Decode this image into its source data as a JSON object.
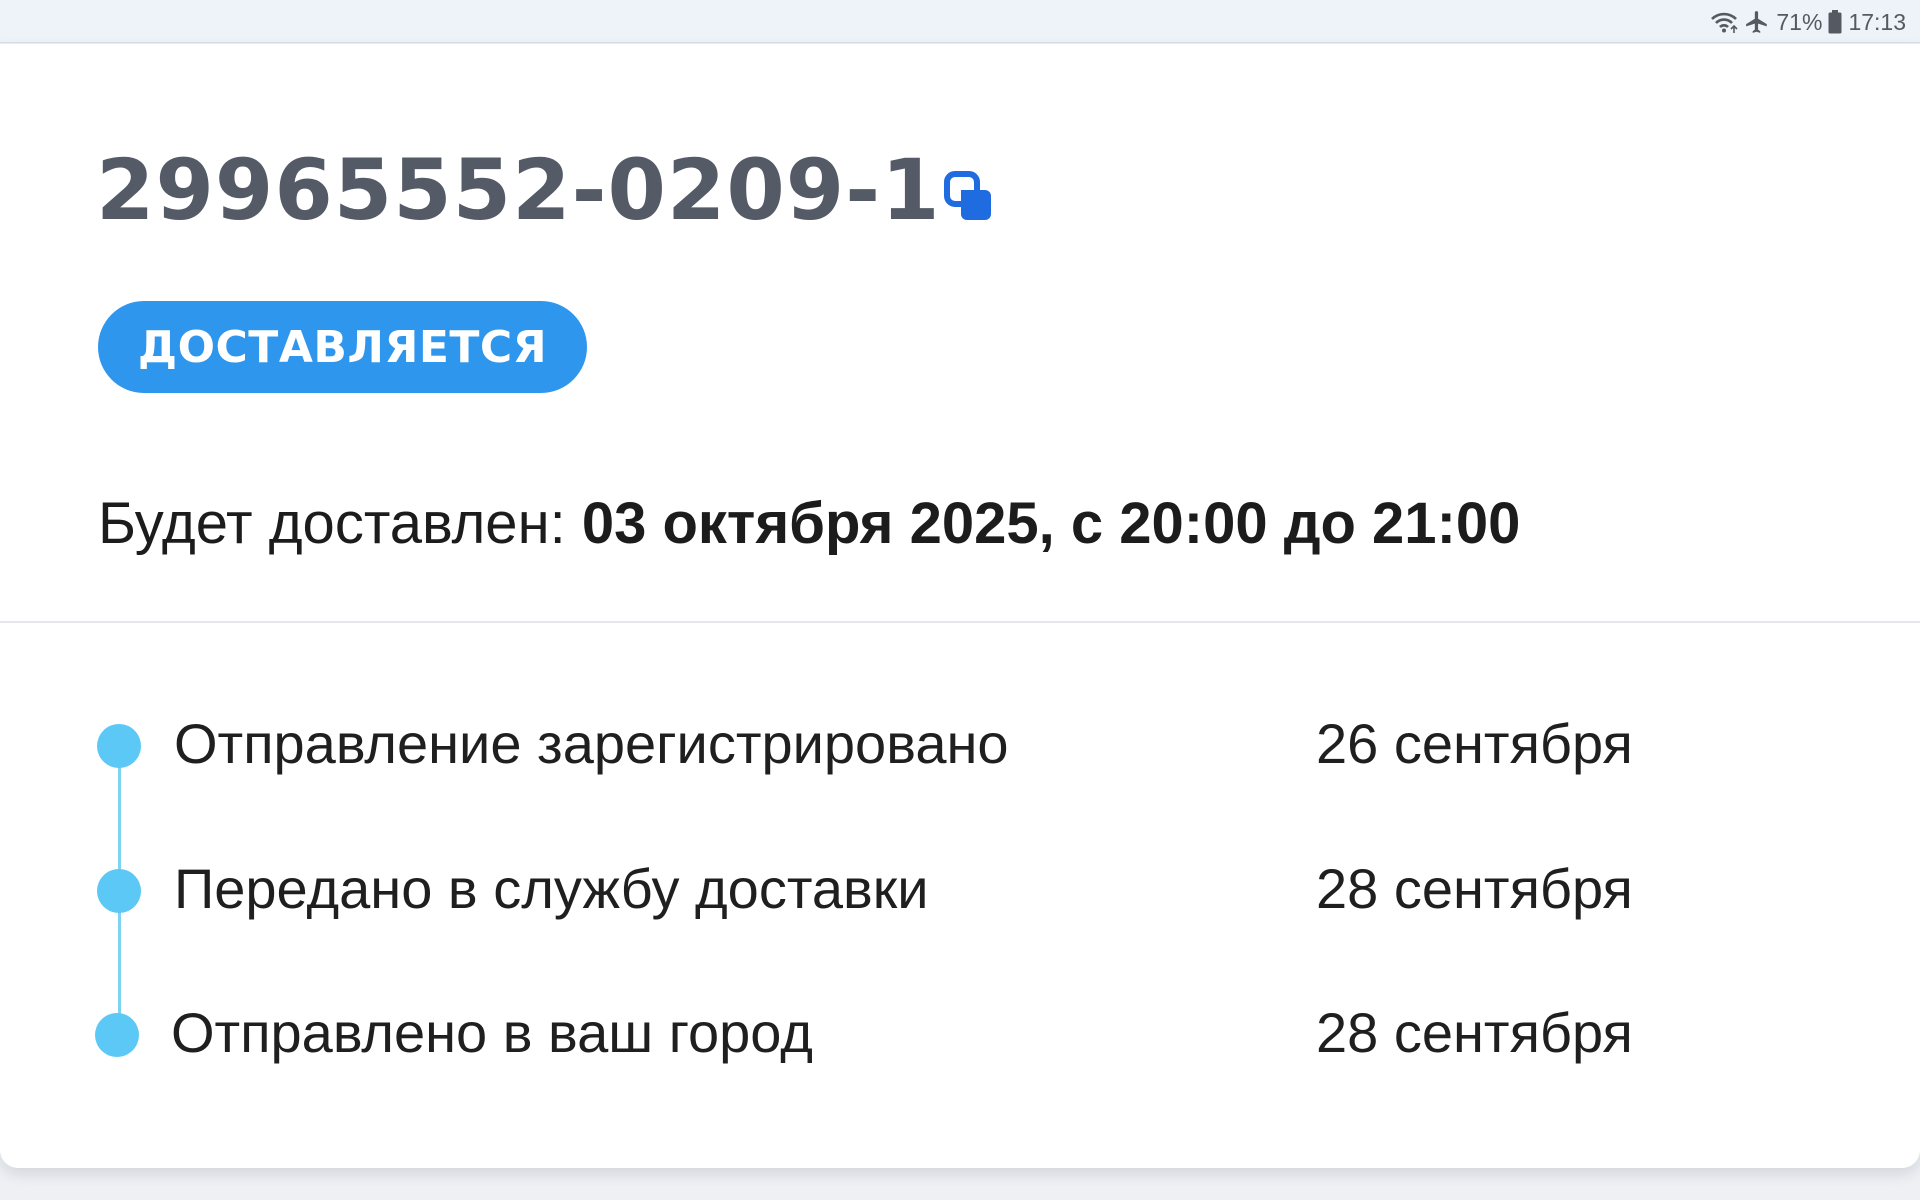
{
  "status_bar": {
    "wifi_icon": "wifi-icon",
    "airplane_icon": "airplane-icon",
    "battery_percent": "71%",
    "battery_icon": "battery-icon",
    "time": "17:13"
  },
  "order": {
    "number": "29965552-0209-1",
    "copy_icon": "copy-icon",
    "status": "ДОСТАВЛЯЕТСЯ",
    "delivery_label": "Будет доставлен: ",
    "delivery_value": "03 октября 2025, с 20:00 до 21:00"
  },
  "timeline": [
    {
      "title": "Отправление зарегистрировано",
      "date": "26 сентября"
    },
    {
      "title": "Передано в службу доставки",
      "date": "28 сентября"
    },
    {
      "title": "Отправлено в ваш город",
      "date": "28 сентября"
    }
  ],
  "colors": {
    "accent": "#2f96ee",
    "timeline_dot": "#5bc8f5",
    "timeline_line": "#7ed3f0",
    "order_number": "#545b66",
    "copy_icon": "#1f6be0"
  }
}
